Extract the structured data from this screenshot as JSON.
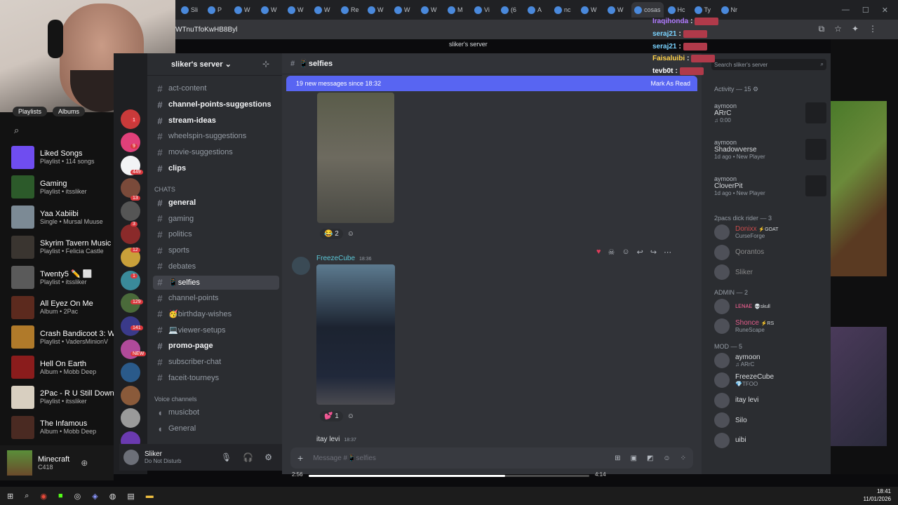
{
  "browser": {
    "tabs": [
      "Sli",
      "P",
      "W",
      "W",
      "W",
      "W",
      "Re",
      "W",
      "W",
      "W",
      "M",
      "Vi",
      "(6",
      "A",
      "nc",
      "W",
      "W",
      "cosas",
      "Hc",
      "Ty",
      "Nr"
    ],
    "url": "WTnuTfoKwHB8Byl",
    "window_title": "sliker's server"
  },
  "spotify": {
    "chips": [
      "Playlists",
      "Albums"
    ],
    "items": [
      {
        "title": "Liked Songs",
        "sub": "Playlist • 114 songs",
        "color": "#6f4df0"
      },
      {
        "title": "Gaming",
        "sub": "Playlist • itssliker",
        "color": "#2c5a2a"
      },
      {
        "title": "Yaa Xabiibi",
        "sub": "Single • Mursal Muuse",
        "color": "#7c8a95"
      },
      {
        "title": "Skyrim Tavern Music",
        "sub": "Playlist • Felicia Castle",
        "color": "#3a3530"
      },
      {
        "title": "Twenty5 ✏️ ⬜",
        "sub": "Playlist • itssliker",
        "color": "#5a5a5a"
      },
      {
        "title": "All Eyez On Me",
        "sub": "Album • 2Pac",
        "color": "#5c2a1e"
      },
      {
        "title": "Crash Bandicoot 3: Wa",
        "sub": "Playlist • VadersMinionV",
        "color": "#b07a2a"
      },
      {
        "title": "Hell On Earth",
        "sub": "Album • Mobb Deep",
        "color": "#8a1c1c"
      },
      {
        "title": "2Pac - R U Still Down?",
        "sub": "Playlist • itssliker",
        "color": "#d8cfc0"
      },
      {
        "title": "The Infamous",
        "sub": "Album • Mobb Deep",
        "color": "#4a2a22"
      }
    ],
    "now_playing": {
      "title": "Minecraft",
      "sub": "C418",
      "time_elapsed": "2:56",
      "time_total": "4:14",
      "progress": 0.7
    }
  },
  "server_badges": [
    "1",
    "9",
    "449",
    "13",
    "3",
    "12",
    "1",
    "129",
    "141",
    "NEW"
  ],
  "channels": {
    "server_name": "sliker's server",
    "list": [
      {
        "name": "act-content",
        "bold": false,
        "selected": false
      },
      {
        "name": "channel-points-suggestions",
        "bold": true,
        "selected": false
      },
      {
        "name": "stream-ideas",
        "bold": true,
        "selected": false
      },
      {
        "name": "wheelspin-suggestions",
        "bold": false,
        "selected": false
      },
      {
        "name": "movie-suggestions",
        "bold": false,
        "selected": false
      },
      {
        "name": "clips",
        "bold": true,
        "selected": false
      }
    ],
    "chats_label": "CHATS",
    "chats": [
      {
        "name": "general",
        "bold": true,
        "selected": false
      },
      {
        "name": "gaming",
        "bold": false,
        "selected": false
      },
      {
        "name": "politics",
        "bold": false,
        "selected": false
      },
      {
        "name": "sports",
        "bold": false,
        "selected": false
      },
      {
        "name": "debates",
        "bold": false,
        "selected": false
      },
      {
        "name": "📱selfies",
        "bold": false,
        "selected": true
      },
      {
        "name": "channel-points",
        "bold": false,
        "selected": false
      },
      {
        "name": "🥳birthday-wishes",
        "bold": false,
        "selected": false
      },
      {
        "name": "💻viewer-setups",
        "bold": false,
        "selected": false
      },
      {
        "name": "promo-page",
        "bold": true,
        "selected": false
      },
      {
        "name": "subscriber-chat",
        "bold": false,
        "selected": false
      },
      {
        "name": "faceit-tourneys",
        "bold": false,
        "selected": false
      }
    ],
    "voice_label": "Voice channels",
    "voice": [
      "musicbot",
      "General"
    ]
  },
  "user_panel": {
    "name": "Sliker",
    "status": "Do Not Disturb"
  },
  "main": {
    "channel": "📱selfies",
    "new_messages": "19 new messages since 18:32",
    "mark_read": "Mark As Read",
    "msg1_reaction": {
      "emoji": "😂",
      "count": "2"
    },
    "msg2_author": "FreezeCube",
    "msg2_time": "18:36",
    "msg2_reaction": {
      "emoji": "💕",
      "count": "1"
    },
    "msg3_author": "itay levi",
    "msg3_time": "18:37",
    "composer_placeholder": "Message #📱selfies"
  },
  "members": {
    "search_placeholder": "Search sliker's server",
    "activity": "Activity — 15 ⚙",
    "activity_items": [
      {
        "user": "aymoon",
        "game": "ARrC",
        "sub": "♫ 0:00"
      },
      {
        "user": "aymoon",
        "game": "Shadowverse",
        "sub": "1d ago • New Player"
      },
      {
        "user": "aymoon",
        "game": "CloverPit",
        "sub": "1d ago • New Player"
      }
    ],
    "groups": [
      {
        "label": "2pacs dick rider — 3",
        "members": [
          {
            "name": "Donixx",
            "sub": "CurseForge",
            "tag": "⚡GOAT",
            "color": "#c94b4b"
          },
          {
            "name": "Qorantos",
            "sub": "",
            "tag": "",
            "color": "#8a8a8a"
          },
          {
            "name": "Sliker",
            "sub": "",
            "tag": "",
            "color": "#8a8a8a"
          }
        ]
      },
      {
        "label": "ADMIN — 2",
        "members": [
          {
            "name": "ʟᴇɴᴀᴇ",
            "sub": "",
            "tag": "💀skull",
            "color": "#e05c8a"
          },
          {
            "name": "Shonce",
            "sub": "RuneScape",
            "tag": "⚡RS",
            "color": "#e05c8a"
          }
        ]
      },
      {
        "label": "MOD — 5",
        "members": [
          {
            "name": "aymoon",
            "sub": "♫ ARrC",
            "tag": "",
            "color": "#dbdee1"
          },
          {
            "name": "FreezeCube",
            "sub": "💎TFOO",
            "tag": "",
            "color": "#dbdee1"
          },
          {
            "name": "itay levi",
            "sub": "",
            "tag": "",
            "color": "#dbdee1"
          },
          {
            "name": "Silo",
            "sub": "",
            "tag": "",
            "color": "#dbdee1"
          },
          {
            "name": "uibi",
            "sub": "",
            "tag": "",
            "color": "#dbdee1"
          }
        ]
      }
    ]
  },
  "chat_overlay": [
    {
      "user": "Iraqihonda",
      "color": "#b07aff"
    },
    {
      "user": "seraj21",
      "color": "#7ad3ff"
    },
    {
      "user": "seraj21",
      "color": "#7ad3ff"
    },
    {
      "user": "Faisaluibi",
      "color": "#ffd24a"
    },
    {
      "user": "tevb0t",
      "color": "#ffffff"
    }
  ],
  "taskbar": {
    "time": "18:41",
    "date": "11/01/2026"
  }
}
